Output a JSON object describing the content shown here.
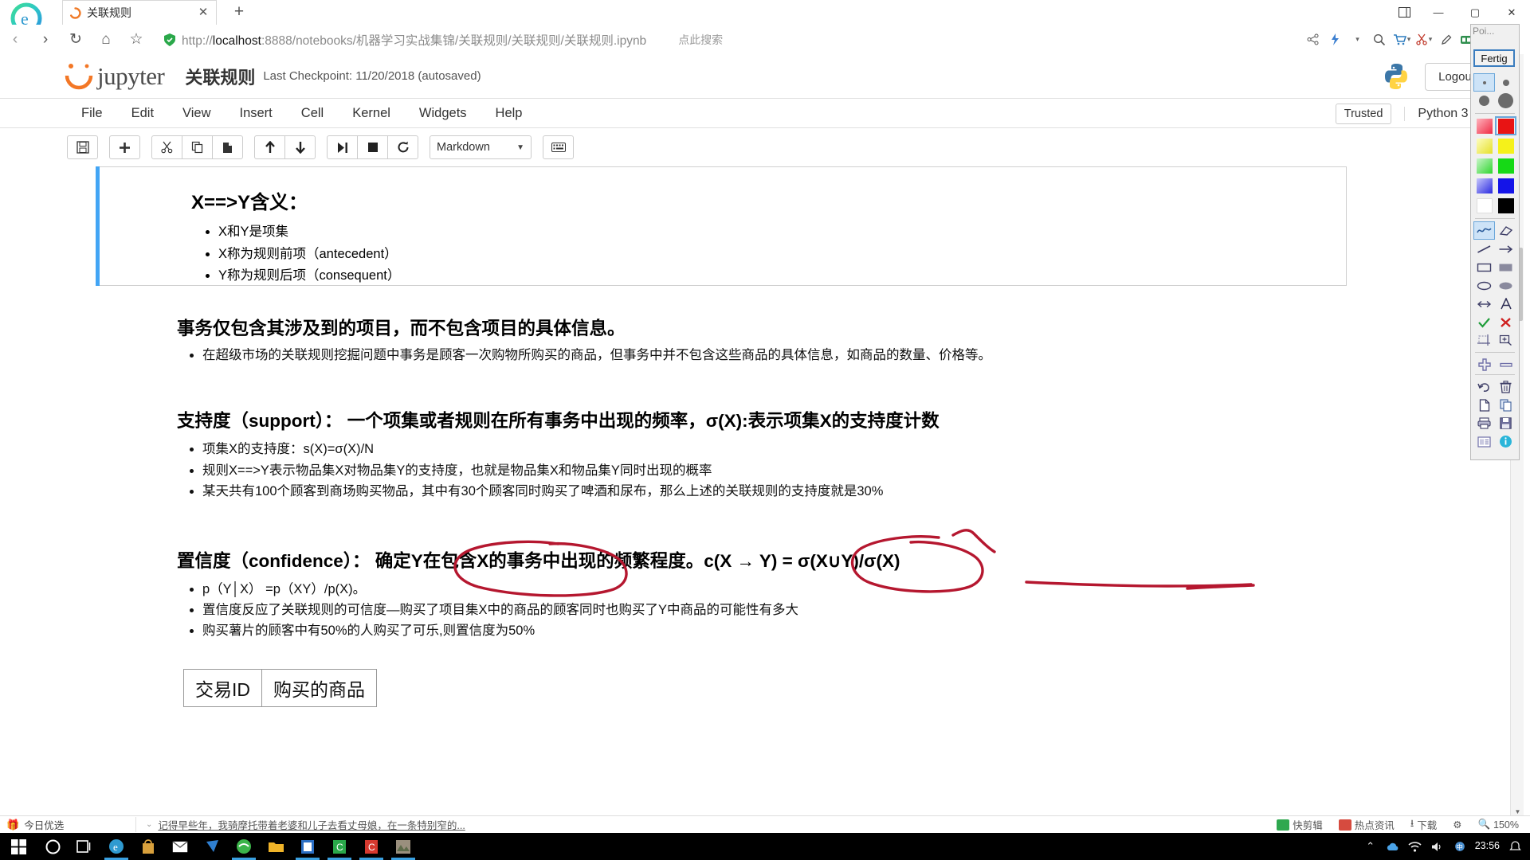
{
  "browser": {
    "tab": {
      "title": "关联规则",
      "close_label": "✕",
      "spinner_icon": "loading-spinner-icon"
    },
    "newtab_label": "+",
    "window_buttons": {
      "pin": "⚏",
      "minimize": "—",
      "maximize": "▢",
      "close": "✕"
    },
    "nav": {
      "back": "‹",
      "forward": "›",
      "refresh": "↻",
      "home": "⌂",
      "favorite": "☆"
    },
    "url": {
      "scheme": "http://",
      "host": "localhost",
      "rest": ":8888/notebooks/机器学习实战集锦/关联规则/关联规则/关联规则.ipynb",
      "full": "http://localhost:8888/notebooks/机器学习实战集锦/关联规则/关联规则/关联规则.ipynb",
      "search_hint": "点此搜索",
      "shield_icon": "shield-icon"
    },
    "toolbar_right": [
      "share-icon",
      "lightning-icon",
      "chevron-down-icon",
      "search-icon",
      "cart-icon",
      "scissors-icon",
      "pen-icon",
      "book-icon",
      "note-icon",
      "more-icon"
    ]
  },
  "jupyter": {
    "logo_text": "jupyter",
    "notebook_title": "关联规则",
    "checkpoint": "Last Checkpoint: 11/20/2018 (autosaved)",
    "logout_label": "Logout",
    "trusted_label": "Trusted",
    "kernel_label": "Python 3",
    "menus": [
      "File",
      "Edit",
      "View",
      "Insert",
      "Cell",
      "Kernel",
      "Widgets",
      "Help"
    ],
    "toolbar": {
      "buttons": [
        {
          "name": "save-button",
          "icon": "💾"
        },
        {
          "name": "insert-cell-below-button",
          "icon": "✚"
        },
        {
          "name": "cut-cell-button",
          "icon": "✂"
        },
        {
          "name": "copy-cell-button",
          "icon": "❐"
        },
        {
          "name": "paste-cell-button",
          "icon": "📋"
        },
        {
          "name": "move-cell-up-button",
          "icon": "↑"
        },
        {
          "name": "move-cell-down-button",
          "icon": "↓"
        },
        {
          "name": "run-cell-button",
          "icon": "▶|"
        },
        {
          "name": "interrupt-kernel-button",
          "icon": "■"
        },
        {
          "name": "restart-kernel-button",
          "icon": "⟳"
        }
      ],
      "cell_type": "Markdown",
      "keyboard_shortcut_icon": "keyboard-icon"
    }
  },
  "notebook": {
    "cell1": {
      "heading": "X==>Y含义：",
      "bullets": [
        "X和Y是项集",
        "X称为规则前项（antecedent）",
        "Y称为规则后项（consequent）"
      ]
    },
    "section2": {
      "heading": "事务仅包含其涉及到的项目，而不包含项目的具体信息。",
      "bullets": [
        "在超级市场的关联规则挖掘问题中事务是顾客一次购物所购买的商品，但事务中并不包含这些商品的具体信息，如商品的数量、价格等。"
      ]
    },
    "section3": {
      "heading": "支持度（support）： 一个项集或者规则在所有事务中出现的频率，σ(X):表示项集X的支持度计数",
      "bullets": [
        "项集X的支持度：s(X)=σ(X)/N",
        "规则X==>Y表示物品集X对物品集Y的支持度，也就是物品集X和物品集Y同时出现的概率",
        "某天共有100个顾客到商场购买物品，其中有30个顾客同时购买了啤酒和尿布，那么上述的关联规则的支持度就是30%"
      ]
    },
    "section4": {
      "heading": "置信度（confidence）： 确定Y在包含X的事务中出现的频繁程度。c(X → Y) = σ(X∪Y)/σ(X)",
      "bullets": [
        "p（Y│X） =p（XY）/p(X)。",
        "置信度反应了关联规则的可信度—购买了项目集X中的商品的顾客同时也购买了Y中商品的可能性有多大",
        "购买薯片的顾客中有50%的人购买了可乐,则置信度为50%"
      ]
    },
    "table": {
      "headers": [
        "交易ID",
        "购买的商品"
      ]
    },
    "annotation_color": "#b5172f"
  },
  "palette": {
    "title": "Poi...",
    "done_label": "Fertig",
    "brush_sizes": [
      "size-tiny",
      "size-small",
      "size-medium",
      "size-large"
    ],
    "colors": [
      "#f45b6e",
      "#e81414",
      "#efe86a",
      "#f5f11a",
      "#7ae07a",
      "#16d916",
      "#6a6af0",
      "#1414e8",
      "#ffffff",
      "#000000"
    ],
    "selected_color": "#e81414",
    "tools": [
      "freehand-icon",
      "eraser-icon",
      "line-icon",
      "arrow-icon",
      "rectangle-icon",
      "filled-rectangle-icon",
      "ellipse-icon",
      "filled-ellipse-icon",
      "double-arrow-icon",
      "text-icon",
      "check-icon",
      "cross-icon",
      "crop-icon",
      "zoom-icon",
      "plus-icon",
      "minus-icon",
      "undo-icon",
      "delete-icon",
      "new-icon",
      "copy-icon",
      "print-icon",
      "save-icon",
      "export-icon",
      "info-icon"
    ]
  },
  "newsbar": {
    "left_label": "今日优选",
    "headline": "记得早些年，我骑摩托带着老婆和儿子去看丈母娘，在一条特别窄的...",
    "right_items": [
      "快剪辑",
      "热点资讯",
      "下载"
    ],
    "zoom_level": "150%"
  },
  "taskbar": {
    "start_icon": "windows-start-icon",
    "items": [
      "cortana-icon",
      "task-view-icon",
      "edge-icon",
      "store-icon",
      "mail-icon",
      "app-blue-icon",
      "browser-green-icon",
      "explorer-icon",
      "office-icon",
      "green-app-icon",
      "red-app-icon",
      "photo-icon"
    ],
    "tray": [
      "up-arrow-icon",
      "cloud-icon",
      "network-icon",
      "volume-icon",
      "ime-icon",
      "notification-icon"
    ],
    "clock": "23:56"
  }
}
